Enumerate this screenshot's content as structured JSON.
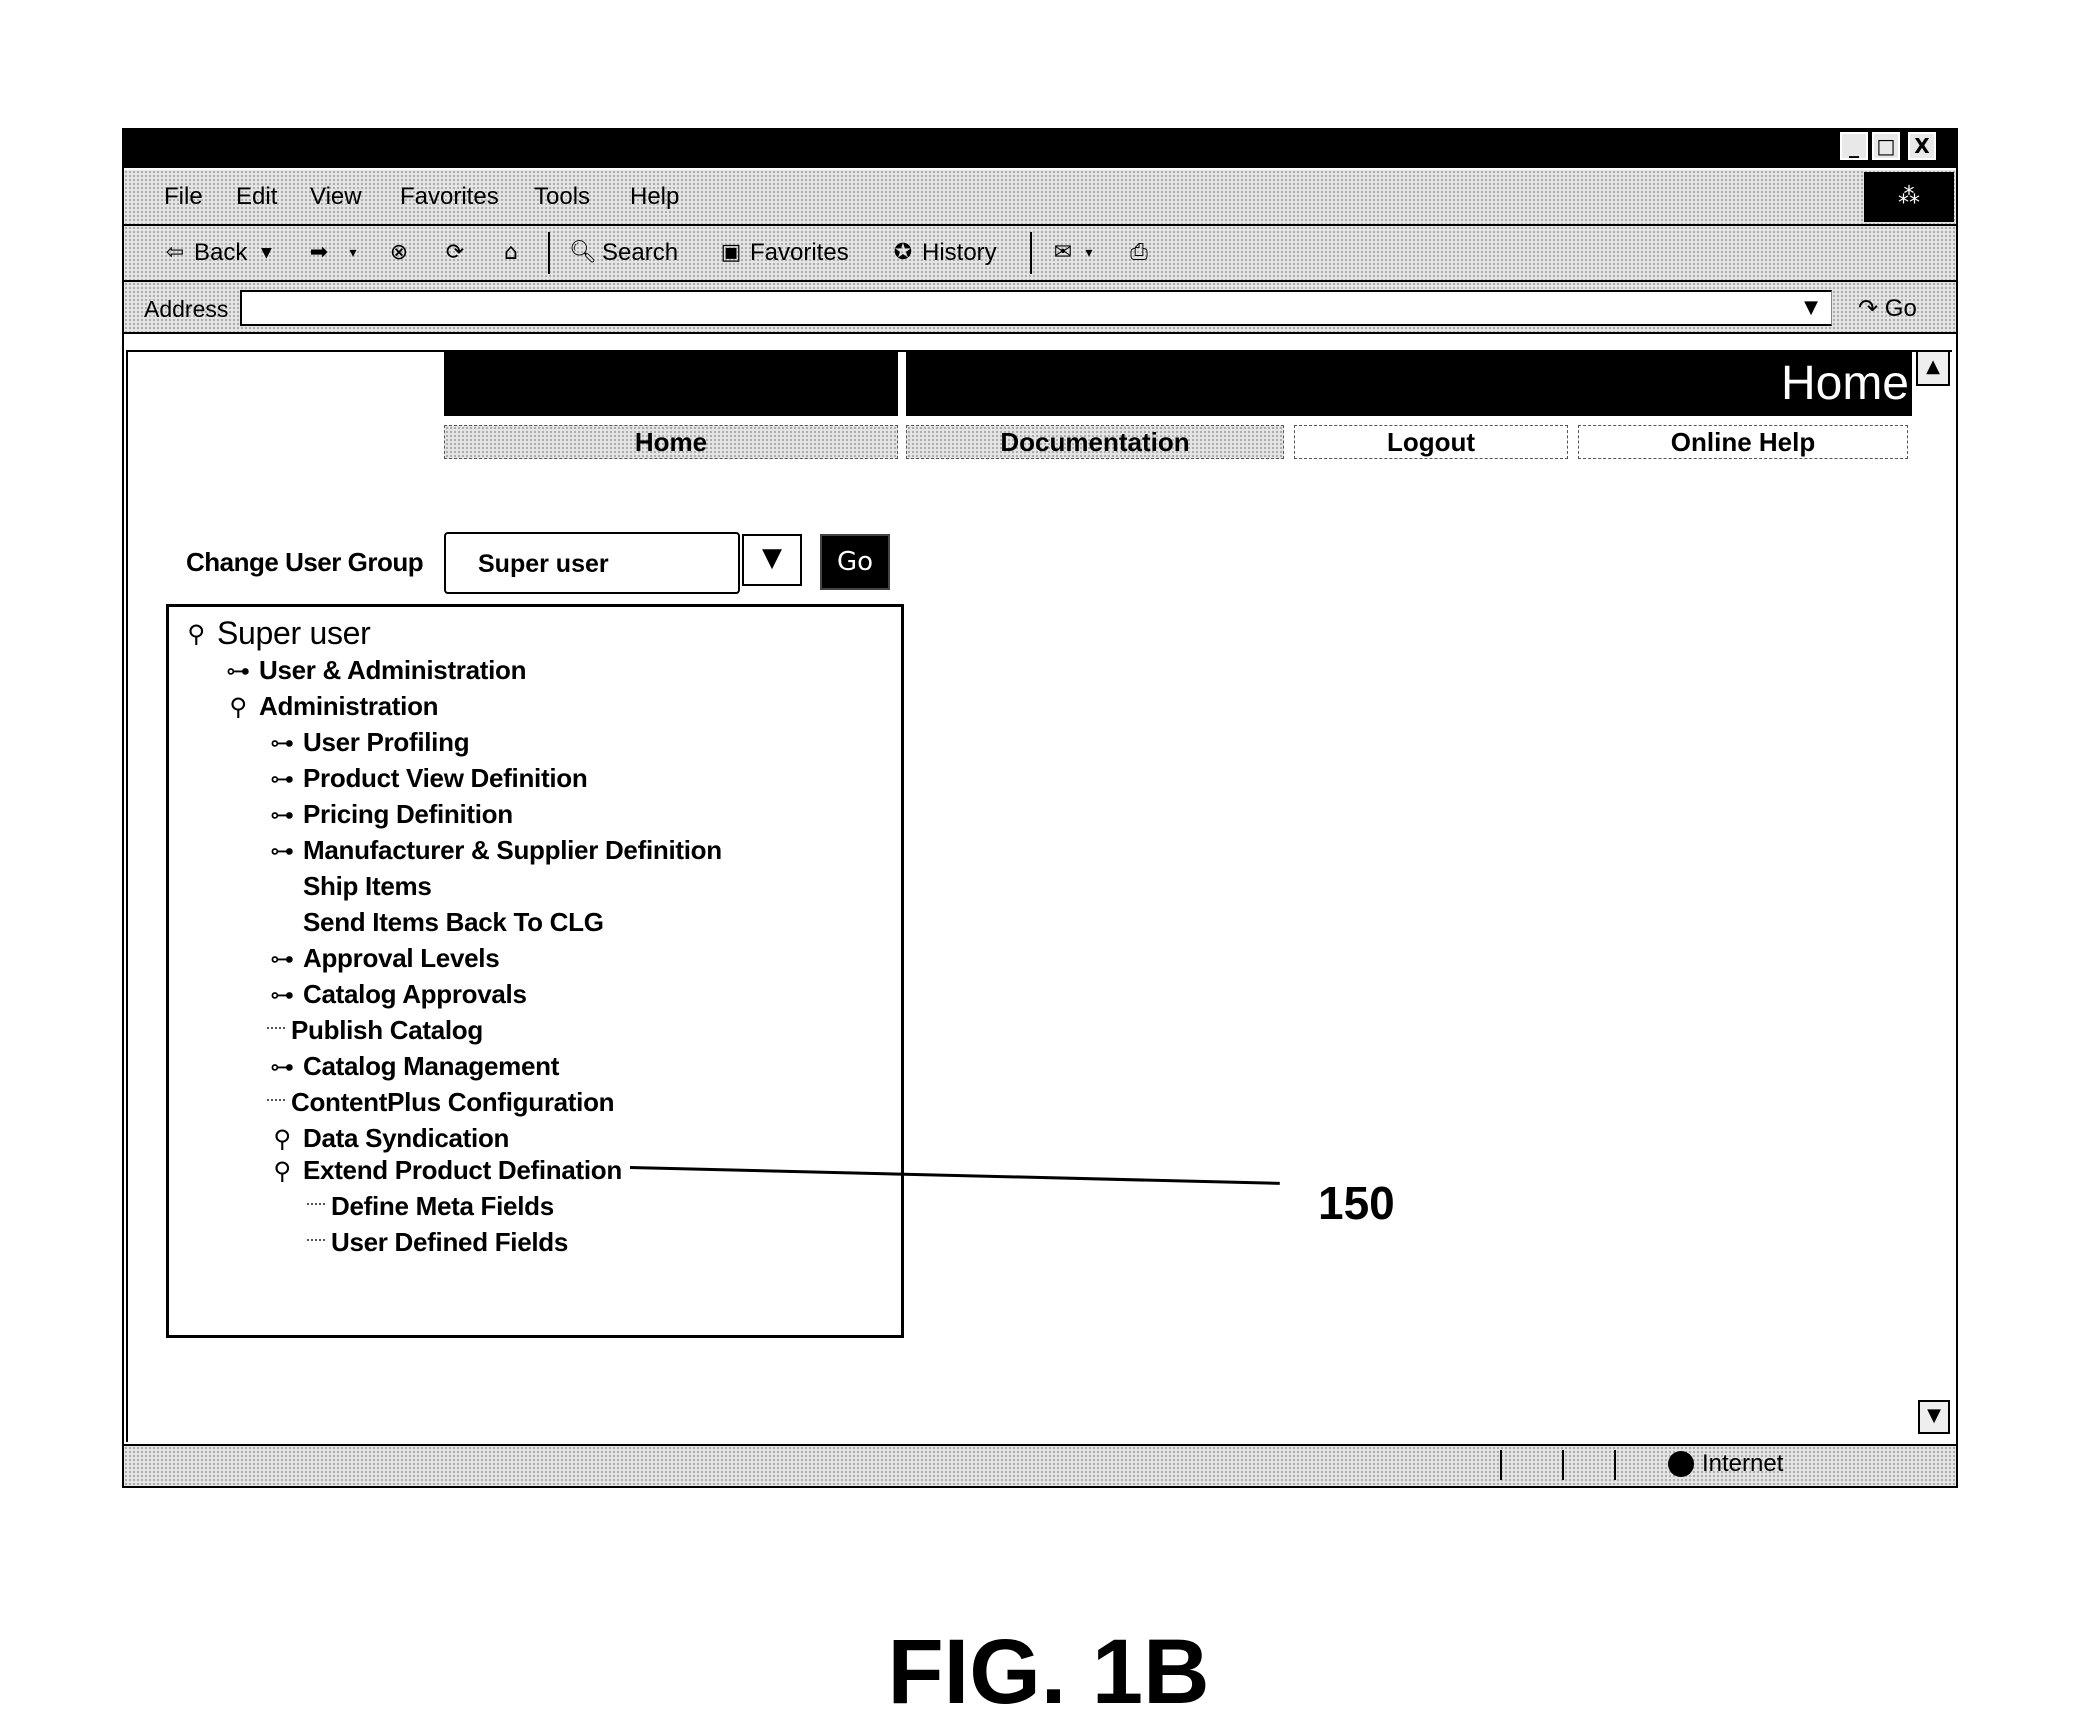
{
  "window": {
    "controls": {
      "minimize": "_",
      "maximize": "□",
      "close": "X"
    }
  },
  "menubar": {
    "items": [
      "File",
      "Edit",
      "View",
      "Favorites",
      "Tools",
      "Help"
    ]
  },
  "toolbar": {
    "back": "Back",
    "search": "Search",
    "favorites": "Favorites",
    "history": "History",
    "icons": {
      "back": "back-arrow-icon",
      "forward": "forward-arrow-icon",
      "stop": "stop-icon",
      "refresh": "refresh-icon",
      "home": "home-icon",
      "search": "search-icon",
      "favorites": "favorites-icon",
      "history": "history-icon",
      "mail": "mail-icon",
      "print": "print-icon"
    }
  },
  "address": {
    "label": "Address",
    "value": "",
    "go_label": "Go"
  },
  "page": {
    "header_title": "Home",
    "nav": [
      "Home",
      "Documentation",
      "Logout",
      "Online Help"
    ],
    "change_user_group": {
      "label": "Change User Group",
      "selected": "Super user",
      "go_label": "Go"
    },
    "tree": [
      {
        "label": "Super user",
        "level": 0,
        "icon": "expanded"
      },
      {
        "label": "User & Administration",
        "level": 1,
        "icon": "collapsed"
      },
      {
        "label": "Administration",
        "level": 1,
        "icon": "expanded"
      },
      {
        "label": "User Profiling",
        "level": 2,
        "icon": "collapsed"
      },
      {
        "label": "Product View Definition",
        "level": 2,
        "icon": "collapsed"
      },
      {
        "label": "Pricing Definition",
        "level": 2,
        "icon": "collapsed"
      },
      {
        "label": "Manufacturer & Supplier Definition",
        "level": 2,
        "icon": "collapsed"
      },
      {
        "label": "Ship Items",
        "level": 2,
        "icon": "none"
      },
      {
        "label": "Send Items Back To CLG",
        "level": 2,
        "icon": "none"
      },
      {
        "label": "Approval Levels",
        "level": 2,
        "icon": "collapsed"
      },
      {
        "label": "Catalog Approvals",
        "level": 2,
        "icon": "collapsed"
      },
      {
        "label": "Publish Catalog",
        "level": 2,
        "icon": "leaf"
      },
      {
        "label": "Catalog Management",
        "level": 2,
        "icon": "collapsed"
      },
      {
        "label": "ContentPlus Configuration",
        "level": 2,
        "icon": "leaf"
      },
      {
        "label": "Data Syndication",
        "level": 2,
        "icon": "expanded"
      },
      {
        "label": "Extend Product Defination",
        "level": 2,
        "icon": "expanded"
      },
      {
        "label": "Define Meta Fields",
        "level": 3,
        "icon": "leaf"
      },
      {
        "label": "User Defined Fields",
        "level": 3,
        "icon": "leaf"
      }
    ]
  },
  "status": {
    "zone": "Internet"
  },
  "annotation": {
    "reference_numeral": "150",
    "figure_label": "FIG. 1B"
  }
}
